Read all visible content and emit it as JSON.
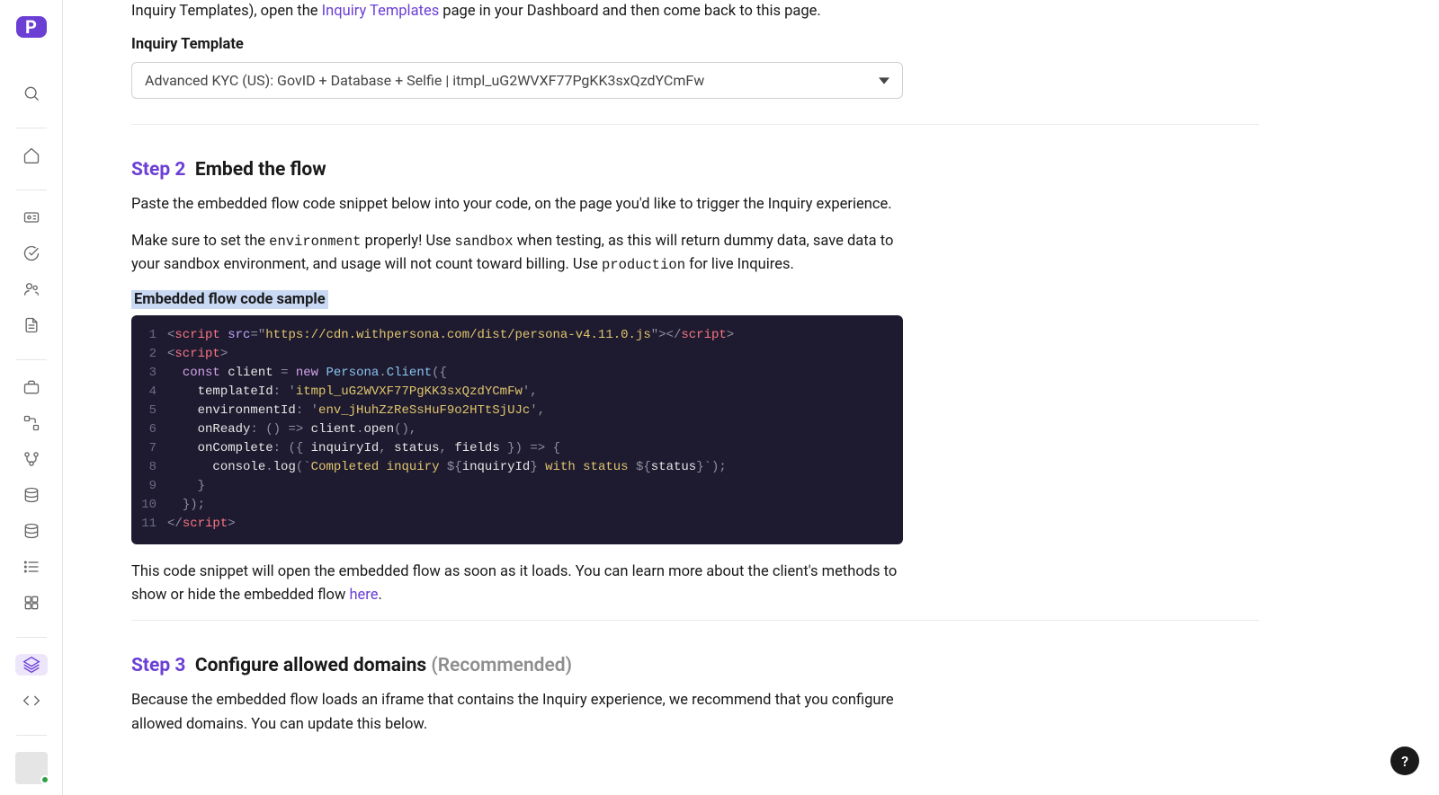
{
  "logo_letter": "P",
  "intro": {
    "prefix": "Inquiry Templates), open the ",
    "link": "Inquiry Templates",
    "suffix": " page in your Dashboard and then come back to this page."
  },
  "template_label": "Inquiry Template",
  "template_select_value": "Advanced KYC (US): GovID + Database + Selfie | itmpl_uG2WVXF77PgKK3sxQzdYCmFw",
  "step2": {
    "label": "Step 2",
    "title": "Embed the flow",
    "para1": "Paste the embedded flow code snippet below into your code, on the page you'd like to trigger the Inquiry experience.",
    "para2_a": "Make sure to set the ",
    "para2_code1": "environment",
    "para2_b": " properly! Use ",
    "para2_code2": "sandbox",
    "para2_c": " when testing, as this will return dummy data, save data to your sandbox environment, and usage will not count toward billing. Use ",
    "para2_code3": "production",
    "para2_d": " for live Inquires.",
    "code_sample_label": "Embedded flow code sample",
    "after_code_a": "This code snippet will open the embedded flow as soon as it loads. You can learn more about the client's methods to show or hide the embedded flow ",
    "after_code_link": "here",
    "after_code_b": "."
  },
  "code": {
    "cdn_url": "https://cdn.withpersona.com/dist/persona-v4.11.0.js",
    "template_id": "itmpl_uG2WVXF77PgKK3sxQzdYCmFw",
    "environment_id": "env_jHuhZzReSsHuF9o2HTtSjUJc"
  },
  "step3": {
    "label": "Step 3",
    "title": "Configure allowed domains",
    "recommended": "(Recommended)",
    "para": "Because the embedded flow loads an iframe that contains the Inquiry experience, we recommend that you configure allowed domains. You can update this below."
  },
  "help_label": "?"
}
